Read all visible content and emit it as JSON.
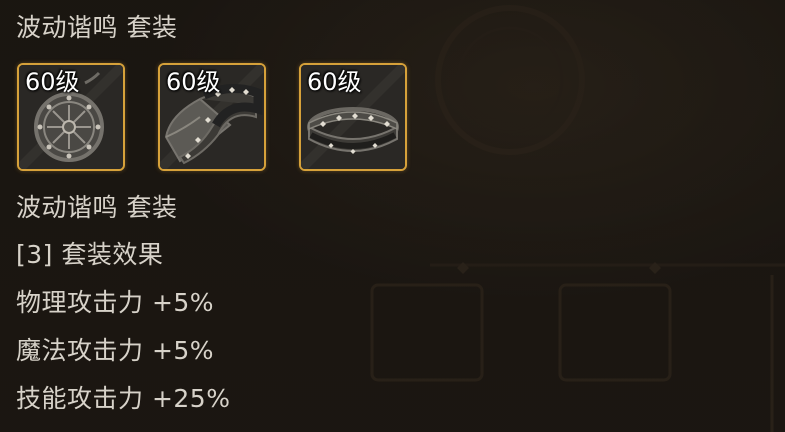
{
  "tooltip": {
    "set_title": "波动谐鸣 套装",
    "items": [
      {
        "level": "60级",
        "icon": "medallion-icon"
      },
      {
        "level": "60级",
        "icon": "bracelet-icon"
      },
      {
        "level": "60级",
        "icon": "ring-icon"
      }
    ],
    "set_name": "波动谐鸣 套装",
    "effect_header": "[3] 套装效果",
    "effects": [
      "物理攻击力 +5%",
      "魔法攻击力 +5%",
      "技能攻击力 +25%"
    ]
  },
  "colors": {
    "text": "#d7d2c9",
    "slot_border": "#d6a13a",
    "background": "#211b15"
  }
}
